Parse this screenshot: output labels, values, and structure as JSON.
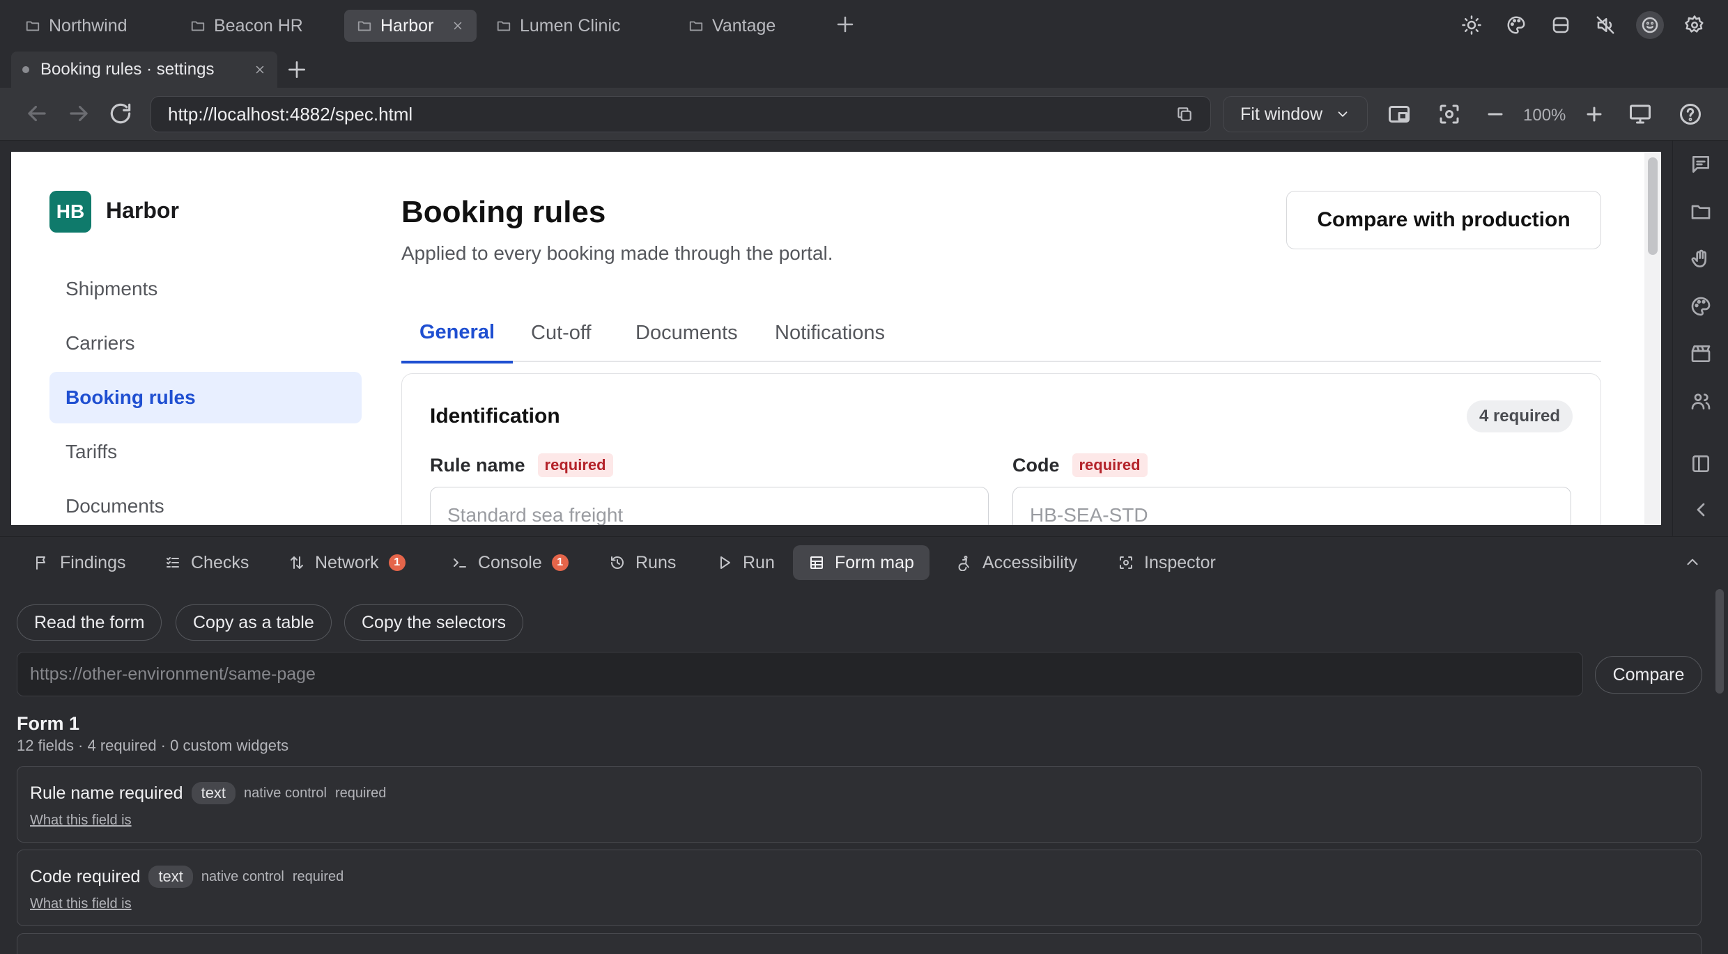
{
  "workspaces": [
    {
      "label": "Northwind",
      "active": false
    },
    {
      "label": "Beacon HR",
      "active": false
    },
    {
      "label": "Harbor",
      "active": true
    },
    {
      "label": "Lumen Clinic",
      "active": false
    },
    {
      "label": "Vantage",
      "active": false
    }
  ],
  "page_tab": {
    "title": "Booking rules · settings"
  },
  "address": {
    "url": "http://localhost:4882/spec.html",
    "fit": "Fit window",
    "zoom": "100%"
  },
  "app": {
    "logo": "HB",
    "brand": "Harbor",
    "nav": [
      "Shipments",
      "Carriers",
      "Booking rules",
      "Tariffs",
      "Documents"
    ],
    "page_title": "Booking rules",
    "page_subtitle": "Applied to every booking made through the portal.",
    "compare_button": "Compare with production",
    "tabs": [
      "General",
      "Cut-off",
      "Documents",
      "Notifications"
    ],
    "section": {
      "title": "Identification",
      "required_count": "4 required",
      "fields": [
        {
          "label": "Rule name",
          "badge": "required",
          "placeholder": "Standard sea freight"
        },
        {
          "label": "Code",
          "badge": "required",
          "placeholder": "HB-SEA-STD"
        }
      ]
    }
  },
  "devtools": {
    "tabs": [
      {
        "label": "Findings",
        "icon": "flag-icon"
      },
      {
        "label": "Checks",
        "icon": "checklist-icon"
      },
      {
        "label": "Network",
        "icon": "arrows-updown-icon",
        "count": "1"
      },
      {
        "label": "Console",
        "icon": "terminal-icon",
        "count": "1"
      },
      {
        "label": "Runs",
        "icon": "history-icon"
      },
      {
        "label": "Run",
        "icon": "play-icon"
      },
      {
        "label": "Form map",
        "icon": "table-icon"
      },
      {
        "label": "Accessibility",
        "icon": "accessibility-icon"
      },
      {
        "label": "Inspector",
        "icon": "inspector-icon"
      }
    ],
    "actions": [
      "Read the form",
      "Copy as a table",
      "Copy the selectors"
    ],
    "compare_placeholder": "https://other-environment/same-page",
    "compare_button": "Compare",
    "form": {
      "title": "Form 1",
      "meta": "12 fields · 4 required · 0 custom widgets",
      "fields": [
        {
          "name": "Rule name required",
          "type": "text",
          "control": "native control",
          "req": "required",
          "link": "What this field is"
        },
        {
          "name": "Code required",
          "type": "text",
          "control": "native control",
          "req": "required",
          "link": "What this field is"
        }
      ]
    }
  },
  "colors": {
    "accent": "#1f4fd1",
    "brand": "#0f7a6b",
    "badge": "#e5654a",
    "required": "#b4232a"
  }
}
